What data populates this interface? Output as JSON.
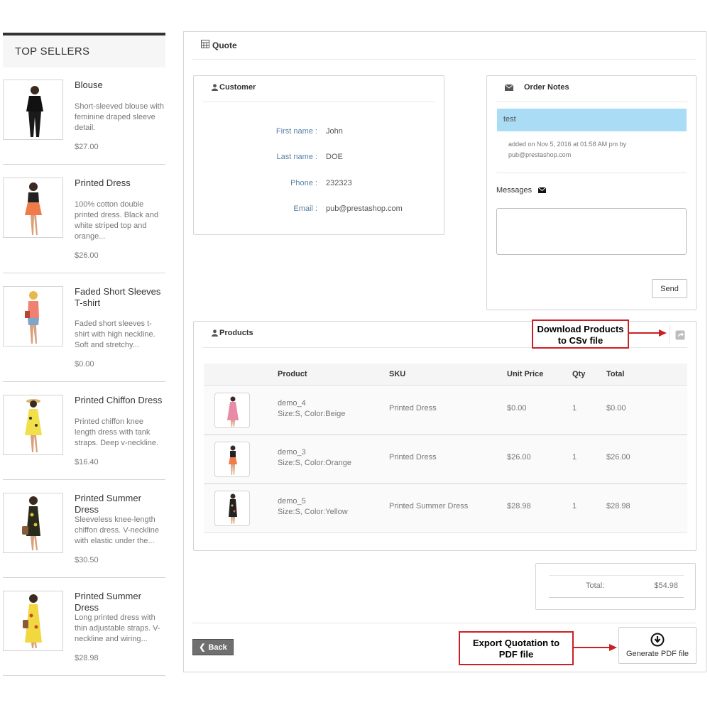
{
  "sidebar": {
    "title": "TOP SELLERS",
    "items": [
      {
        "name": "Blouse",
        "desc": "Short-sleeved blouse with feminine draped sleeve detail.",
        "price": "$27.00"
      },
      {
        "name": "Printed Dress",
        "desc": "100% cotton double printed dress. Black and white striped top and orange...",
        "price": "$26.00"
      },
      {
        "name": "Faded Short Sleeves T-shirt",
        "desc": "Faded short sleeves t-shirt with high neckline. Soft and stretchy...",
        "price": "$0.00"
      },
      {
        "name": "Printed Chiffon Dress",
        "desc": "Printed chiffon knee length dress with tank straps. Deep v-neckline.",
        "price": "$16.40"
      },
      {
        "name": "Printed Summer Dress",
        "desc": "Sleeveless knee-length chiffon dress. V-neckline with elastic under the...",
        "price": "$30.50"
      },
      {
        "name": "Printed Summer Dress",
        "desc": "Long printed dress with thin adjustable straps. V-neckline and wiring...",
        "price": "$28.98"
      }
    ]
  },
  "quote": {
    "title": "Quote"
  },
  "customer": {
    "title": "Customer",
    "fields": [
      {
        "label": "First name :",
        "value": "John"
      },
      {
        "label": "Last name :",
        "value": "DOE"
      },
      {
        "label": "Phone :",
        "value": "232323"
      },
      {
        "label": "Email :",
        "value": "pub@prestashop.com"
      }
    ]
  },
  "order_notes": {
    "title": "Order Notes",
    "note_text": "test",
    "note_meta_line1": "added on Nov 5, 2016 at 01:58 AM pm by",
    "note_meta_line2": "pub@prestashop.com",
    "messages_label": "Messages",
    "send_label": "Send"
  },
  "products": {
    "title": "Products",
    "headers": {
      "product": "Product",
      "sku": "SKU",
      "unit_price": "Unit Price",
      "qty": "Qty",
      "total": "Total"
    },
    "rows": [
      {
        "ref": "demo_4",
        "attrs": "Size:S, Color:Beige",
        "sku": "Printed Dress",
        "unit_price": "$0.00",
        "qty": "1",
        "total": "$0.00"
      },
      {
        "ref": "demo_3",
        "attrs": "Size:S, Color:Orange",
        "sku": "Printed Dress",
        "unit_price": "$26.00",
        "qty": "1",
        "total": "$26.00"
      },
      {
        "ref": "demo_5",
        "attrs": "Size:S, Color:Yellow",
        "sku": "Printed Summer Dress",
        "unit_price": "$28.98",
        "qty": "1",
        "total": "$28.98"
      }
    ]
  },
  "callouts": {
    "csv_line1": "Download Products",
    "csv_line2": "to CSv file",
    "pdf_line1": "Export Quotation to",
    "pdf_line2": "PDF file"
  },
  "totals": {
    "label": "Total:",
    "value": "$54.98"
  },
  "footer": {
    "back_label": "Back",
    "pdf_label": "Generate PDF file"
  },
  "colors": {
    "accent_blue": "#5a7fa5",
    "note_bg": "#aadcf6",
    "callout_red": "#cc1f24"
  }
}
